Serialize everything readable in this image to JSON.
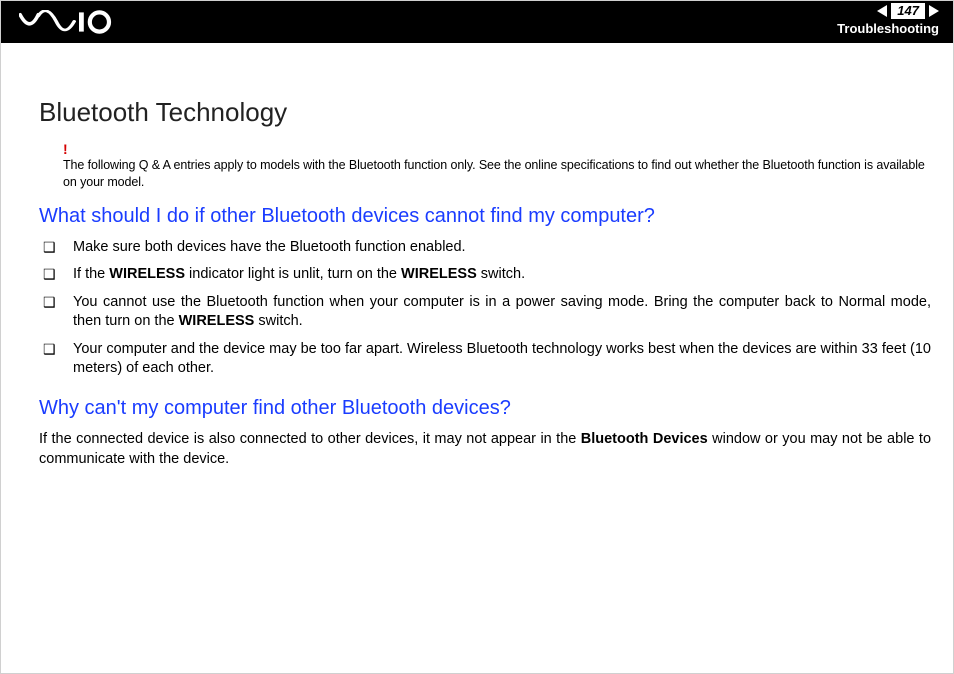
{
  "header": {
    "page_number": "147",
    "section": "Troubleshooting"
  },
  "title": "Bluetooth Technology",
  "note": {
    "mark": "!",
    "text": "The following Q & A entries apply to models with the Bluetooth function only. See the online specifications to find out whether the Bluetooth function is available on your model."
  },
  "q1": {
    "heading": "What should I do if other Bluetooth devices cannot find my computer?",
    "items": [
      {
        "pre": "Make sure both devices have the Bluetooth function enabled."
      },
      {
        "pre": "If the ",
        "b1": "WIRELESS",
        "mid": " indicator light is unlit, turn on the ",
        "b2": "WIRELESS",
        "post": " switch."
      },
      {
        "pre": "You cannot use the Bluetooth function when your computer is in a power saving mode. Bring the computer back to Normal mode, then turn on the ",
        "b1": "WIRELESS",
        "post": " switch."
      },
      {
        "pre": "Your computer and the device may be too far apart. Wireless Bluetooth technology works best when the devices are within 33 feet (10 meters) of each other."
      }
    ]
  },
  "q2": {
    "heading": "Why can't my computer find other Bluetooth devices?",
    "para_pre": "If the connected device is also connected to other devices, it may not appear in the ",
    "para_b": "Bluetooth Devices",
    "para_post": " window or you may not be able to communicate with the device."
  }
}
